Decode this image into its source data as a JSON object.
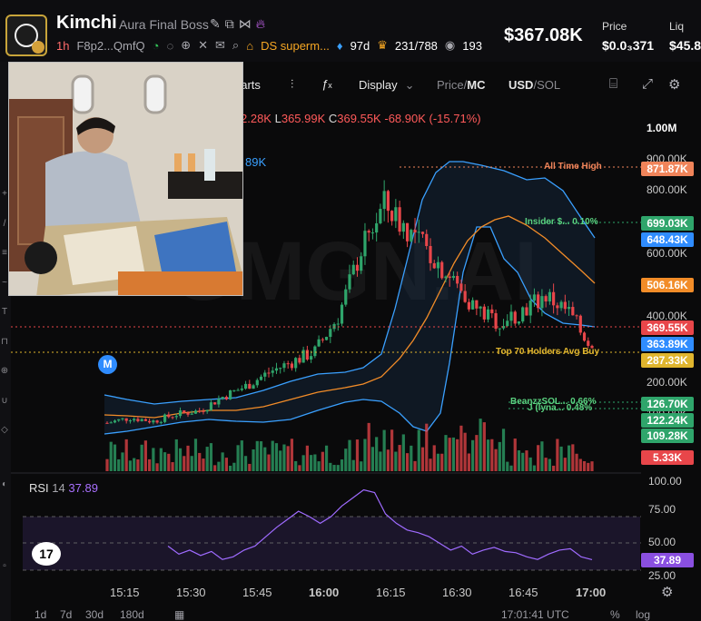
{
  "header": {
    "title": "Kimchi",
    "subtitle": "Aura Final Boss",
    "timeframe": "1h",
    "address": "F8p2...QmfQ",
    "dev_label": "DS superm...",
    "age": "97d",
    "holders": "231/788",
    "watchers": "193",
    "market_cap": "$367.08K",
    "price_label": "Price",
    "price_value": "$0.0₃371",
    "liq_label": "Liq",
    "liq_value": "$45.8"
  },
  "toolbar": {
    "charts_label": "harts",
    "display_label": "Display",
    "price_mc_a": "Price",
    "price_mc_sep": "/",
    "price_mc_b": "MC",
    "usd_sol_a": "USD",
    "usd_sol_sep": "/",
    "usd_sol_b": "SOL"
  },
  "ohlc": {
    "frag": "2.28K",
    "l_label": "L",
    "l_value": "365.99K",
    "c_label": "C",
    "c_value": "369.55K",
    "change": "-68.90K (-15.71%)"
  },
  "bb_value": "89K",
  "markers": {
    "ath": "All Time High",
    "insider": "Insider $... 0.10%",
    "top70": "Top 70 Holders Avg Buy",
    "beanzz": "BeanzzSOL... 0.66%",
    "j": "J (lyna... 0.48%"
  },
  "price_tags": [
    {
      "label": "871.87K",
      "color": "#f0845a"
    },
    {
      "label": "699.03K",
      "color": "#2fa56b"
    },
    {
      "label": "648.43K",
      "color": "#2f8cff"
    },
    {
      "label": "506.16K",
      "color": "#f28c28"
    },
    {
      "label": "369.55K",
      "color": "#e8464a"
    },
    {
      "label": "363.89K",
      "color": "#2f8cff"
    },
    {
      "label": "287.33K",
      "color": "#e0b52e"
    },
    {
      "label": "126.70K",
      "color": "#2fa56b"
    },
    {
      "label": "122.24K",
      "color": "#2fa56b"
    },
    {
      "label": "109.28K",
      "color": "#2fa56b"
    },
    {
      "label": "5.33K",
      "color": "#e8464a"
    },
    {
      "label": "37.89",
      "color": "#8a4fe0"
    }
  ],
  "y_axis": [
    "1.00M",
    "900.00K",
    "800.00K",
    "700.00K",
    "600.00K",
    "500.00K",
    "400.00K",
    "300.00K",
    "200.00K",
    "100.00K"
  ],
  "rsi_axis": [
    "100.00",
    "75.00",
    "50.00",
    "25.00"
  ],
  "x_axis": [
    "15:15",
    "15:30",
    "15:45",
    "16:00",
    "16:15",
    "16:30",
    "16:45",
    "17:00"
  ],
  "rsi": {
    "label": "RSI",
    "period": "14",
    "value": "37.89"
  },
  "m_badge": "M",
  "tv_logo": "17",
  "watermark": "GMGN.AI",
  "bottom_bar": {
    "ranges": [
      "1d",
      "7d",
      "30d",
      "180d"
    ],
    "time": "17:01:41 UTC",
    "pct": "%",
    "log": "log"
  },
  "chart_data": [
    {
      "type": "candlestick",
      "title": "",
      "x": [
        "15:15",
        "15:30",
        "15:45",
        "16:00",
        "16:15",
        "16:30",
        "16:45",
        "17:00"
      ],
      "ylim": [
        0,
        1000000
      ],
      "close_series": [
        155000,
        170000,
        160000,
        180000,
        190000,
        230000,
        260000,
        300000,
        330000,
        360000,
        460000,
        650000,
        780000,
        710000,
        640000,
        560000,
        480000,
        440000,
        480000,
        520000,
        470000,
        369550
      ],
      "overlays": [
        {
          "name": "Upper band",
          "color": "#3aa0ff"
        },
        {
          "name": "MA",
          "color": "#f28c28"
        },
        {
          "name": "Lower band",
          "color": "#3aa0ff"
        }
      ],
      "reference_lines": [
        {
          "label": "All Time High",
          "value": 871870
        },
        {
          "label": "Insider $... 0.10%",
          "value": 699030
        },
        {
          "label": "Top 70 Holders Avg Buy",
          "value": 287330
        },
        {
          "label": "BeanzzSOL... 0.66%",
          "value": 126700
        },
        {
          "label": "J (lyna... 0.48%",
          "value": 122240
        },
        {
          "label": "Current",
          "value": 369550
        }
      ]
    },
    {
      "type": "line",
      "title": "RSI 14",
      "ylim": [
        25,
        100
      ],
      "latest": 37.89,
      "values": [
        48,
        42,
        45,
        41,
        44,
        38,
        40,
        45,
        48,
        55,
        62,
        68,
        74,
        70,
        65,
        70,
        78,
        84,
        90,
        88,
        72,
        65,
        60,
        58,
        55,
        50,
        45,
        48,
        42,
        45,
        47,
        44,
        43,
        40,
        38,
        42,
        45,
        46,
        40,
        37.89
      ]
    }
  ]
}
